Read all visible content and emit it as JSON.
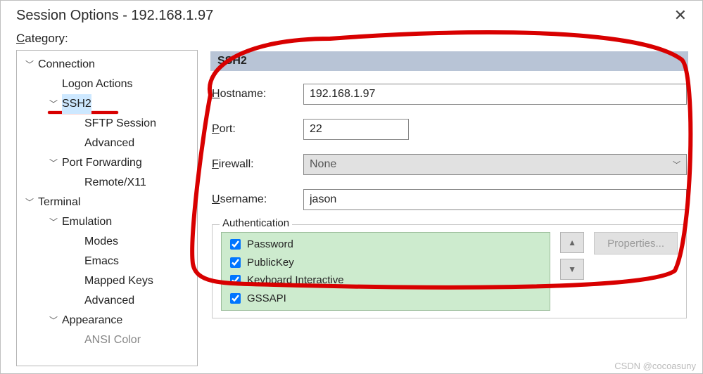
{
  "window": {
    "title": "Session Options - 192.168.1.97"
  },
  "sidebar": {
    "label_prefix": "C",
    "label_rest": "ategory:"
  },
  "tree": {
    "connection": "Connection",
    "logon_actions": "Logon Actions",
    "ssh2": "SSH2",
    "sftp_session": "SFTP Session",
    "advanced1": "Advanced",
    "port_forwarding": "Port Forwarding",
    "remote_x11": "Remote/X11",
    "terminal": "Terminal",
    "emulation": "Emulation",
    "modes": "Modes",
    "emacs": "Emacs",
    "mapped_keys": "Mapped Keys",
    "advanced2": "Advanced",
    "appearance": "Appearance",
    "ansi_color": "ANSI Color"
  },
  "panel": {
    "title": "SSH2",
    "hostname_u": "H",
    "hostname_rest": "ostname:",
    "hostname_value": "192.168.1.97",
    "port_u": "P",
    "port_rest": "ort:",
    "port_value": "22",
    "firewall_u": "F",
    "firewall_rest": "irewall:",
    "firewall_value": "None",
    "username_u": "U",
    "username_rest": "sername:",
    "username_value": "jason"
  },
  "auth": {
    "legend": "Authentication",
    "items": [
      "Password",
      "PublicKey",
      "Keyboard Interactive",
      "GSSAPI"
    ],
    "properties": "Properties..."
  },
  "watermark": "CSDN @cocoasuny"
}
